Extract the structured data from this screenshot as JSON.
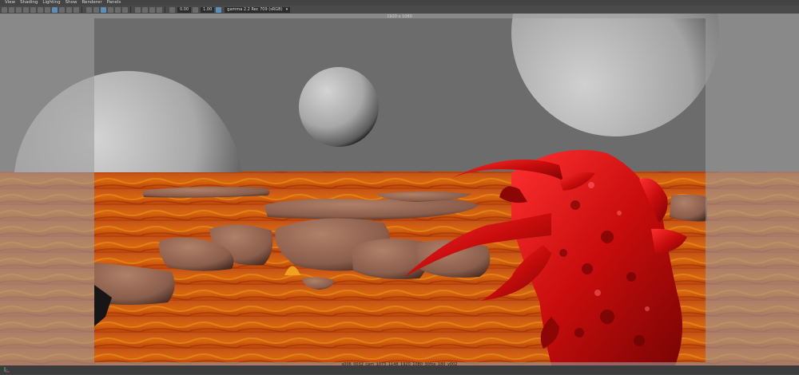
{
  "menubar": {
    "items": [
      {
        "label": "View",
        "name": "menu-view"
      },
      {
        "label": "Shading",
        "name": "menu-shading"
      },
      {
        "label": "Lighting",
        "name": "menu-lighting"
      },
      {
        "label": "Show",
        "name": "menu-show"
      },
      {
        "label": "Renderer",
        "name": "menu-renderer"
      },
      {
        "label": "Panels",
        "name": "menu-panels"
      }
    ]
  },
  "toolbar": {
    "exposure_value": "0.00",
    "gamma_value": "1.00",
    "color_space": "gamma 2.2 Rec 709 (sRGB)",
    "accent": "#5b8fb9"
  },
  "viewport": {
    "resolution_label": "1920 x 1080",
    "camera_label": "s006_0032_cam_1073_1148_1920_1080_30fps_180_v002",
    "sky_color": "#707070",
    "lava_color": "#c85a10",
    "creature_color": "#d01010"
  }
}
